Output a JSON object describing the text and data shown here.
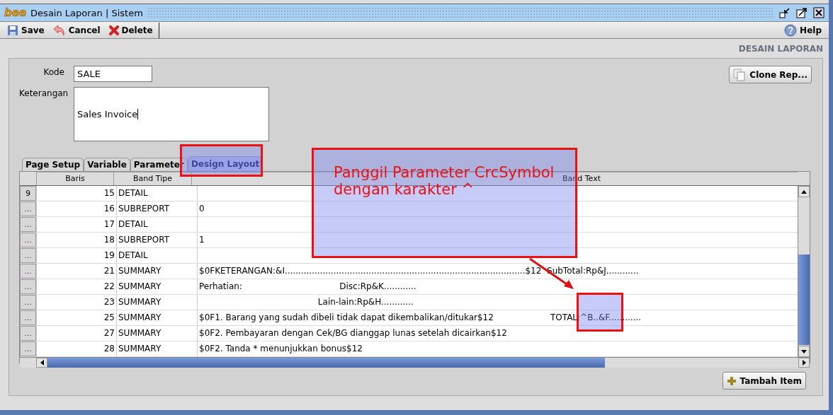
{
  "window": {
    "logo": "bee",
    "title": "Desain Laporan | Sistem"
  },
  "toolbar": [
    {
      "label": "Save",
      "kind": "save"
    },
    {
      "label": "Cancel",
      "kind": "cancel"
    },
    {
      "label": "Delete",
      "kind": "delete"
    }
  ],
  "help": "Help",
  "page_title": "DESAIN LAPORAN",
  "form": {
    "kode_label": "Kode",
    "kode_value": "SALE",
    "keterangan_label": "Keterangan",
    "keterangan_value": "Sales Invoice"
  },
  "clone_button": "Clone Rep...",
  "tabs": [
    {
      "label": "Page Setup",
      "selected": false
    },
    {
      "label": "Variable",
      "selected": false
    },
    {
      "label": "Parameter",
      "selected": false
    },
    {
      "label": "Design Layout",
      "selected": true
    }
  ],
  "table": {
    "columns": [
      "Baris",
      "Band Tipe",
      "Band Text"
    ],
    "rows": [
      {
        "row_header": "9",
        "baris": "15",
        "band_tipe": "DETAIL",
        "band_text": ""
      },
      {
        "row_header": "...",
        "baris": "16",
        "band_tipe": "SUBREPORT",
        "band_text": "0"
      },
      {
        "row_header": "...",
        "baris": "17",
        "band_tipe": "DETAIL",
        "band_text": ""
      },
      {
        "row_header": "...",
        "baris": "18",
        "band_tipe": "SUBREPORT",
        "band_text": "1"
      },
      {
        "row_header": "...",
        "baris": "19",
        "band_tipe": "DETAIL",
        "band_text": ""
      },
      {
        "row_header": "...",
        "baris": "21",
        "band_tipe": "SUMMARY",
        "band_text": "$0FKETERANGAN:&I.........................................................................................$12  SubTotal:Rp&J............"
      },
      {
        "row_header": "...",
        "baris": "22",
        "band_tipe": "SUMMARY",
        "band_text": "Perhatian:                                    Disc:Rp&K............"
      },
      {
        "row_header": "...",
        "baris": "23",
        "band_tipe": "SUMMARY",
        "band_text": "                                            Lain-lain:Rp&H............"
      },
      {
        "row_header": "...",
        "baris": "25",
        "band_tipe": "SUMMARY",
        "band_text": "$0F1. Barang yang sudah dibeli tidak dapat dikembalikan/ditukar$12                     TOTAL:^B..&F............"
      },
      {
        "row_header": "...",
        "baris": "27",
        "band_tipe": "SUMMARY",
        "band_text": "$0F2. Pembayaran dengan Cek/BG dianggap lunas setelah dicairkan$12"
      },
      {
        "row_header": "...",
        "baris": "28",
        "band_tipe": "SUMMARY",
        "band_text": "$0F2. Tanda * menunjukkan bonus$12"
      }
    ]
  },
  "add_button": "Tambah Item",
  "annotation": {
    "callout": "Panggil Parameter CrcSymbol dengan karakter ^"
  }
}
